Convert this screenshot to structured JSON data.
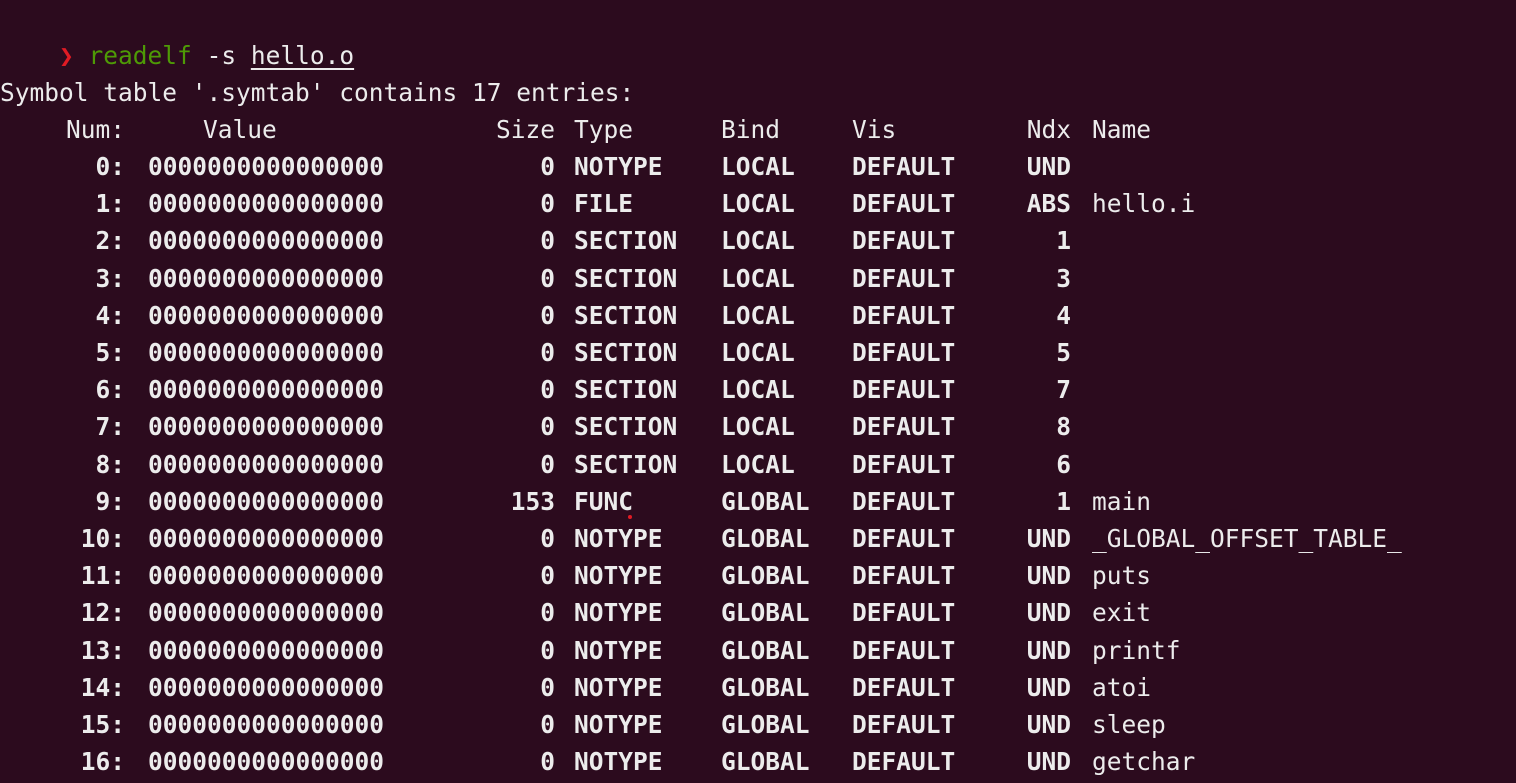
{
  "command": {
    "arrow": "❯",
    "name": "readelf",
    "flag": " -s ",
    "file": "hello.o"
  },
  "table_title": "Symbol table '.symtab' contains 17 entries:",
  "columns": {
    "num": "Num:",
    "value": "Value",
    "size": "Size",
    "type": "Type",
    "bind": "Bind",
    "vis": "Vis",
    "ndx": "Ndx",
    "name": "Name"
  },
  "rows": [
    {
      "num": "0:",
      "value": "0000000000000000",
      "size": "0",
      "type": "NOTYPE",
      "bind": "LOCAL",
      "vis": "DEFAULT",
      "ndx": "UND",
      "name": ""
    },
    {
      "num": "1:",
      "value": "0000000000000000",
      "size": "0",
      "type": "FILE",
      "bind": "LOCAL",
      "vis": "DEFAULT",
      "ndx": "ABS",
      "name": "hello.i"
    },
    {
      "num": "2:",
      "value": "0000000000000000",
      "size": "0",
      "type": "SECTION",
      "bind": "LOCAL",
      "vis": "DEFAULT",
      "ndx": "1",
      "name": ""
    },
    {
      "num": "3:",
      "value": "0000000000000000",
      "size": "0",
      "type": "SECTION",
      "bind": "LOCAL",
      "vis": "DEFAULT",
      "ndx": "3",
      "name": ""
    },
    {
      "num": "4:",
      "value": "0000000000000000",
      "size": "0",
      "type": "SECTION",
      "bind": "LOCAL",
      "vis": "DEFAULT",
      "ndx": "4",
      "name": ""
    },
    {
      "num": "5:",
      "value": "0000000000000000",
      "size": "0",
      "type": "SECTION",
      "bind": "LOCAL",
      "vis": "DEFAULT",
      "ndx": "5",
      "name": ""
    },
    {
      "num": "6:",
      "value": "0000000000000000",
      "size": "0",
      "type": "SECTION",
      "bind": "LOCAL",
      "vis": "DEFAULT",
      "ndx": "7",
      "name": ""
    },
    {
      "num": "7:",
      "value": "0000000000000000",
      "size": "0",
      "type": "SECTION",
      "bind": "LOCAL",
      "vis": "DEFAULT",
      "ndx": "8",
      "name": ""
    },
    {
      "num": "8:",
      "value": "0000000000000000",
      "size": "0",
      "type": "SECTION",
      "bind": "LOCAL",
      "vis": "DEFAULT",
      "ndx": "6",
      "name": ""
    },
    {
      "num": "9:",
      "value": "0000000000000000",
      "size": "153",
      "type": "FUNC",
      "bind": "GLOBAL",
      "vis": "DEFAULT",
      "ndx": "1",
      "name": "main"
    },
    {
      "num": "10:",
      "value": "0000000000000000",
      "size": "0",
      "type": "NOTYPE",
      "bind": "GLOBAL",
      "vis": "DEFAULT",
      "ndx": "UND",
      "name": "_GLOBAL_OFFSET_TABLE_"
    },
    {
      "num": "11:",
      "value": "0000000000000000",
      "size": "0",
      "type": "NOTYPE",
      "bind": "GLOBAL",
      "vis": "DEFAULT",
      "ndx": "UND",
      "name": "puts"
    },
    {
      "num": "12:",
      "value": "0000000000000000",
      "size": "0",
      "type": "NOTYPE",
      "bind": "GLOBAL",
      "vis": "DEFAULT",
      "ndx": "UND",
      "name": "exit"
    },
    {
      "num": "13:",
      "value": "0000000000000000",
      "size": "0",
      "type": "NOTYPE",
      "bind": "GLOBAL",
      "vis": "DEFAULT",
      "ndx": "UND",
      "name": "printf"
    },
    {
      "num": "14:",
      "value": "0000000000000000",
      "size": "0",
      "type": "NOTYPE",
      "bind": "GLOBAL",
      "vis": "DEFAULT",
      "ndx": "UND",
      "name": "atoi"
    },
    {
      "num": "15:",
      "value": "0000000000000000",
      "size": "0",
      "type": "NOTYPE",
      "bind": "GLOBAL",
      "vis": "DEFAULT",
      "ndx": "UND",
      "name": "sleep"
    },
    {
      "num": "16:",
      "value": "0000000000000000",
      "size": "0",
      "type": "NOTYPE",
      "bind": "GLOBAL",
      "vis": "DEFAULT",
      "ndx": "UND",
      "name": "getchar"
    }
  ],
  "colors": {
    "background": "#2c0b1e",
    "text": "#ececec",
    "prompt_arrow": "#e01b24",
    "command": "#4e9a06"
  }
}
